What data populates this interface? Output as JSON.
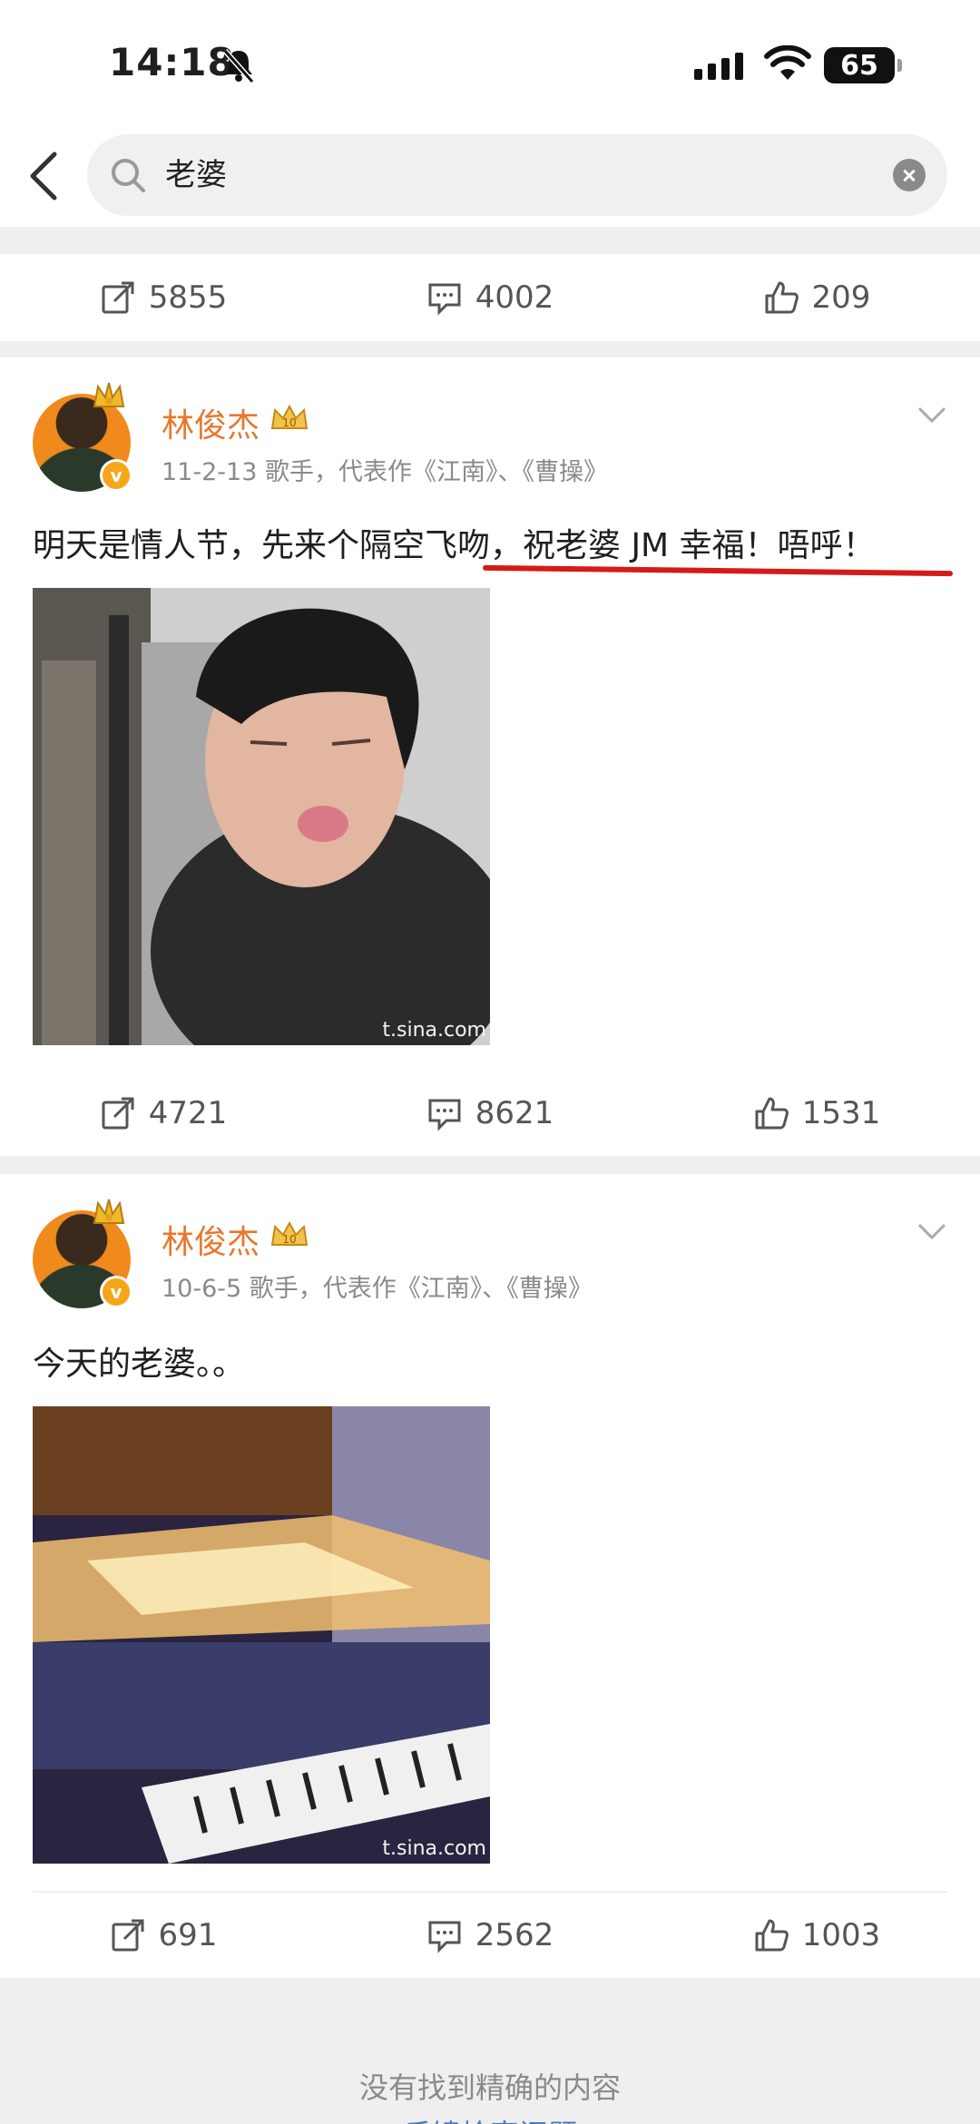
{
  "status_bar": {
    "time": "14:18",
    "battery": "65"
  },
  "search": {
    "query": "老婆"
  },
  "top_actions": {
    "repost": "5855",
    "comment": "4002",
    "like": "209"
  },
  "posts": [
    {
      "username": "林俊杰",
      "meta": "11-2-13  歌手，代表作《江南》、《曹操》",
      "text": "明天是情人节，先来个隔空飞吻，祝老婆 JM 幸福！唔呼！",
      "watermark": "t.sina.com",
      "repost": "4721",
      "comment": "8621",
      "like": "1531"
    },
    {
      "username": "林俊杰",
      "meta": "10-6-5  歌手，代表作《江南》、《曹操》",
      "text": "今天的老婆。。",
      "watermark": "t.sina.com",
      "repost": "691",
      "comment": "2562",
      "like": "1003"
    }
  ],
  "footer": {
    "message": "没有找到精确的内容",
    "link": "反馈检索问题"
  },
  "colors": {
    "accent_orange": "#e8772e",
    "underline_red": "#d61a1a",
    "link_blue": "#4a7bbf"
  }
}
